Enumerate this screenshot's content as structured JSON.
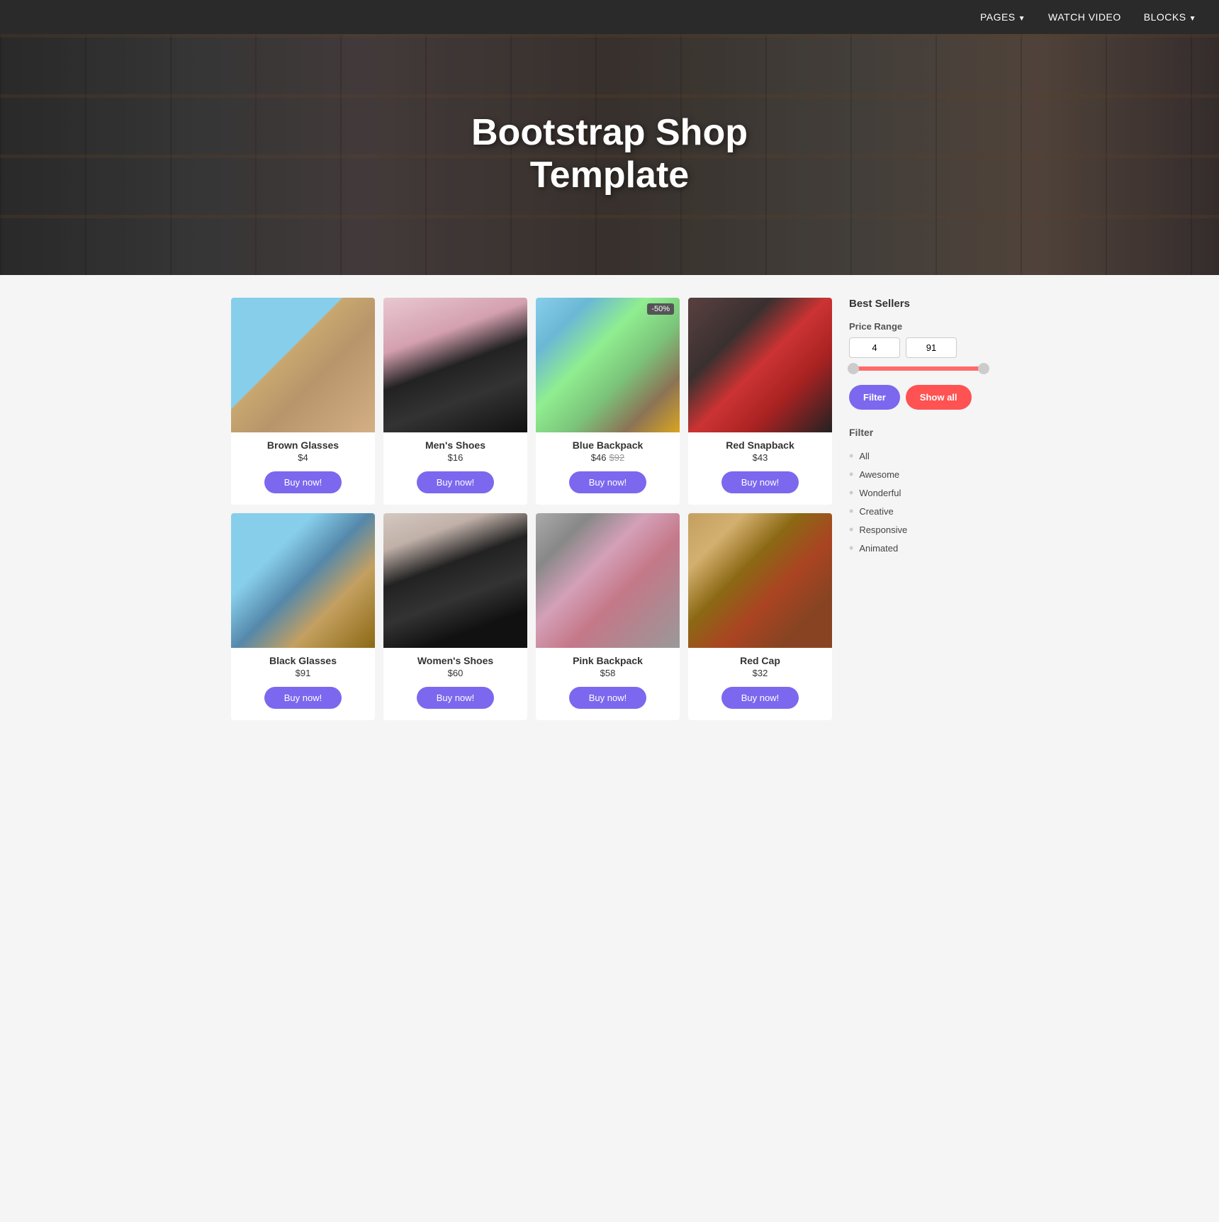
{
  "nav": {
    "items": [
      {
        "label": "PAGES",
        "has_caret": true
      },
      {
        "label": "WATCH VIDEO",
        "has_caret": false
      },
      {
        "label": "BLOCKS",
        "has_caret": true
      }
    ]
  },
  "hero": {
    "title_line1": "Bootstrap Shop",
    "title_line2": "Template"
  },
  "products": [
    {
      "id": "brown-glasses",
      "name": "Brown Glasses",
      "price": "$4",
      "original_price": null,
      "badge": null,
      "img_class": "img-brown-glasses",
      "buy_label": "Buy now!"
    },
    {
      "id": "mens-shoes",
      "name": "Men's Shoes",
      "price": "$16",
      "original_price": null,
      "badge": null,
      "img_class": "img-mens-shoes",
      "buy_label": "Buy now!"
    },
    {
      "id": "blue-backpack",
      "name": "Blue Backpack",
      "price": "$46",
      "original_price": "$92",
      "badge": "-50%",
      "img_class": "img-blue-backpack",
      "buy_label": "Buy now!"
    },
    {
      "id": "red-snapback",
      "name": "Red Snapback",
      "price": "$43",
      "original_price": null,
      "badge": null,
      "img_class": "img-red-snapback",
      "buy_label": "Buy now!"
    },
    {
      "id": "black-glasses",
      "name": "Black Glasses",
      "price": "$91",
      "original_price": null,
      "badge": null,
      "img_class": "img-black-glasses",
      "buy_label": "Buy now!"
    },
    {
      "id": "womens-shoes",
      "name": "Women's Shoes",
      "price": "$60",
      "original_price": null,
      "badge": null,
      "img_class": "img-womens-shoes",
      "buy_label": "Buy now!"
    },
    {
      "id": "pink-backpack",
      "name": "Pink Backpack",
      "price": "$58",
      "original_price": null,
      "badge": null,
      "img_class": "img-pink-backpack",
      "buy_label": "Buy now!"
    },
    {
      "id": "red-cap",
      "name": "Red Cap",
      "price": "$32",
      "original_price": null,
      "badge": null,
      "img_class": "img-red-cap",
      "buy_label": "Buy now!"
    }
  ],
  "sidebar": {
    "best_sellers_label": "Best Sellers",
    "price_range_label": "Price Range",
    "price_min": "4",
    "price_max": "91",
    "btn_filter_label": "Filter",
    "btn_show_all_label": "Show all",
    "filter_label": "Filter",
    "filter_items": [
      {
        "label": "All"
      },
      {
        "label": "Awesome"
      },
      {
        "label": "Wonderful"
      },
      {
        "label": "Creative"
      },
      {
        "label": "Responsive"
      },
      {
        "label": "Animated"
      }
    ]
  }
}
